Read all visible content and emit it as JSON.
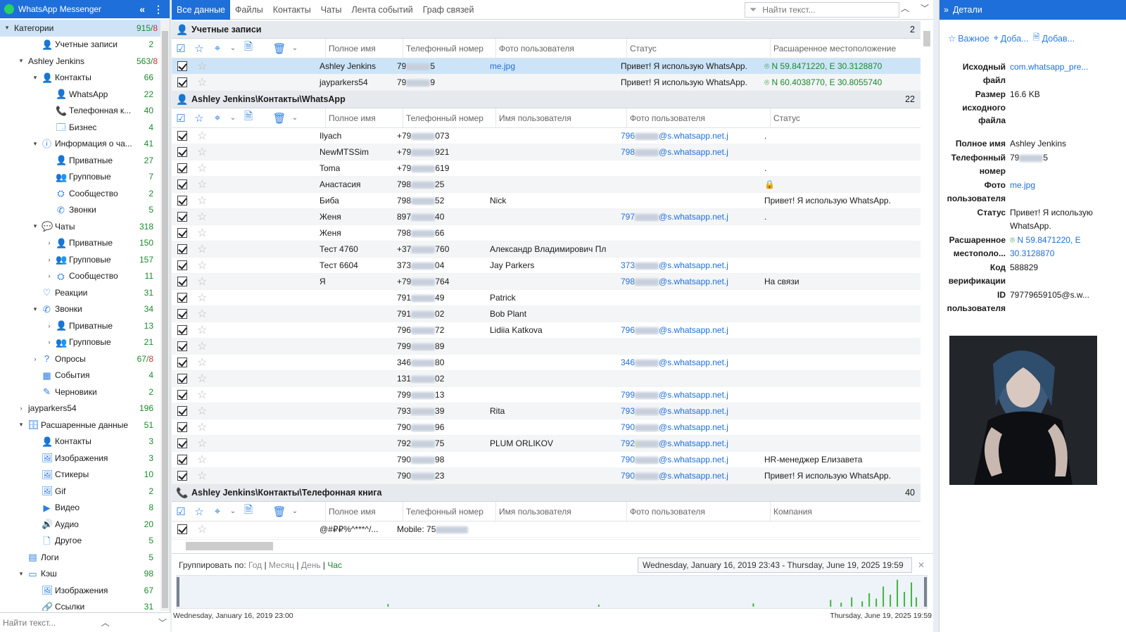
{
  "app": {
    "title": "WhatsApp Messenger"
  },
  "tree": [
    {
      "label": "Категории",
      "count": "915",
      "count_red": "8",
      "indent": 0,
      "toggle": "▾",
      "icon": "",
      "sel": true
    },
    {
      "label": "Учетные записи",
      "count": "2",
      "indent": 2,
      "toggle": "",
      "icon": "👤"
    },
    {
      "label": "Ashley Jenkins",
      "count": "563",
      "count_red": "8",
      "indent": 1,
      "toggle": "▾",
      "icon": ""
    },
    {
      "label": "Контакты",
      "count": "66",
      "indent": 2,
      "toggle": "▾",
      "icon": "👤"
    },
    {
      "label": "WhatsApp",
      "count": "22",
      "indent": 3,
      "toggle": "",
      "icon": "👤"
    },
    {
      "label": "Телефонная к...",
      "count": "40",
      "indent": 3,
      "toggle": "",
      "icon": "📞"
    },
    {
      "label": "Бизнес",
      "count": "4",
      "indent": 3,
      "toggle": "",
      "icon": "🗔"
    },
    {
      "label": "Информация о ча...",
      "count": "41",
      "indent": 2,
      "toggle": "▾",
      "icon": "ⓘ"
    },
    {
      "label": "Приватные",
      "count": "27",
      "indent": 3,
      "toggle": "",
      "icon": "👤"
    },
    {
      "label": "Групповые",
      "count": "7",
      "indent": 3,
      "toggle": "",
      "icon": "👥"
    },
    {
      "label": "Сообщество",
      "count": "2",
      "indent": 3,
      "toggle": "",
      "icon": "⛭"
    },
    {
      "label": "Звонки",
      "count": "5",
      "indent": 3,
      "toggle": "",
      "icon": "✆"
    },
    {
      "label": "Чаты",
      "count": "318",
      "indent": 2,
      "toggle": "▾",
      "icon": "💬"
    },
    {
      "label": "Приватные",
      "count": "150",
      "indent": 3,
      "toggle": "›",
      "icon": "👤"
    },
    {
      "label": "Групповые",
      "count": "157",
      "indent": 3,
      "toggle": "›",
      "icon": "👥"
    },
    {
      "label": "Сообщество",
      "count": "11",
      "indent": 3,
      "toggle": "›",
      "icon": "⛭"
    },
    {
      "label": "Реакции",
      "count": "31",
      "indent": 2,
      "toggle": "",
      "icon": "♡"
    },
    {
      "label": "Звонки",
      "count": "34",
      "indent": 2,
      "toggle": "▾",
      "icon": "✆"
    },
    {
      "label": "Приватные",
      "count": "13",
      "indent": 3,
      "toggle": "›",
      "icon": "👤"
    },
    {
      "label": "Групповые",
      "count": "21",
      "indent": 3,
      "toggle": "›",
      "icon": "👥"
    },
    {
      "label": "Опросы",
      "count": "67",
      "count_red": "8",
      "indent": 2,
      "toggle": "›",
      "icon": "?"
    },
    {
      "label": "События",
      "count": "4",
      "indent": 2,
      "toggle": "",
      "icon": "▦"
    },
    {
      "label": "Черновики",
      "count": "2",
      "indent": 2,
      "toggle": "",
      "icon": "✎"
    },
    {
      "label": "jayparkers54",
      "count": "196",
      "indent": 1,
      "toggle": "›",
      "icon": ""
    },
    {
      "label": "Расшаренные данные",
      "count": "51",
      "indent": 1,
      "toggle": "▾",
      "icon": "🗄"
    },
    {
      "label": "Контакты",
      "count": "3",
      "indent": 2,
      "toggle": "",
      "icon": "👤"
    },
    {
      "label": "Изображения",
      "count": "3",
      "indent": 2,
      "toggle": "",
      "icon": "🖼"
    },
    {
      "label": "Стикеры",
      "count": "10",
      "indent": 2,
      "toggle": "",
      "icon": "🖼"
    },
    {
      "label": "Gif",
      "count": "2",
      "indent": 2,
      "toggle": "",
      "icon": "🖼"
    },
    {
      "label": "Видео",
      "count": "8",
      "indent": 2,
      "toggle": "",
      "icon": "▶"
    },
    {
      "label": "Аудио",
      "count": "20",
      "indent": 2,
      "toggle": "",
      "icon": "🔊"
    },
    {
      "label": "Другое",
      "count": "5",
      "indent": 2,
      "toggle": "",
      "icon": "🗋"
    },
    {
      "label": "Логи",
      "count": "5",
      "indent": 1,
      "toggle": "",
      "icon": "▤"
    },
    {
      "label": "Кэш",
      "count": "98",
      "indent": 1,
      "toggle": "▾",
      "icon": "▭"
    },
    {
      "label": "Изображения",
      "count": "67",
      "indent": 2,
      "toggle": "",
      "icon": "🖼"
    },
    {
      "label": "Ссылки",
      "count": "31",
      "indent": 2,
      "toggle": "",
      "icon": "🔗"
    }
  ],
  "left_search": {
    "placeholder": "Найти текст..."
  },
  "tabs": [
    "Все данные",
    "Файлы",
    "Контакты",
    "Чаты",
    "Лента событий",
    "Граф связей"
  ],
  "center_search": {
    "placeholder": "Найти текст..."
  },
  "sections": [
    {
      "title": "Учетные записи",
      "count": "2",
      "icon": "👤",
      "columns": [
        "Полное имя",
        "Телефонный номер",
        "Фото пользователя",
        "Статус",
        "Расшаренное местоположение"
      ],
      "rows": [
        {
          "c": [
            "Ashley Jenkins",
            "79|5",
            "me.jpg",
            "Привет! Я использую WhatsApp.",
            "N 59.8471220, E 30.3128870"
          ],
          "sel": true
        },
        {
          "c": [
            "jayparkers54",
            "79|9",
            "",
            "Привет! Я использую WhatsApp.",
            "N 60.4038770, E 30.8055740"
          ]
        }
      ]
    },
    {
      "title": "Ashley Jenkins\\Контакты\\WhatsApp",
      "count": "22",
      "icon": "👤",
      "columns": [
        "Полное имя",
        "Телефонный номер",
        "Имя пользователя",
        "Фото пользователя",
        "Статус"
      ],
      "rows": [
        {
          "c": [
            "Ilyach",
            "+79|073",
            "",
            "796|@s.whatsapp.net.j",
            "."
          ]
        },
        {
          "c": [
            "NewMTSSim",
            "+79|921",
            "",
            "798|@s.whatsapp.net.j",
            ""
          ]
        },
        {
          "c": [
            "Toma",
            "+79|619",
            "",
            "",
            "."
          ]
        },
        {
          "c": [
            "Анастасия",
            "798|25",
            "",
            "",
            "🔒"
          ]
        },
        {
          "c": [
            "Биба",
            "798|52",
            "Nick",
            "",
            "Привет! Я использую WhatsApp."
          ]
        },
        {
          "c": [
            "Женя",
            "897|40",
            "",
            "797|@s.whatsapp.net.j",
            "."
          ]
        },
        {
          "c": [
            "Женя",
            "798|66",
            "",
            "",
            ""
          ]
        },
        {
          "c": [
            "Тест 4760",
            "+37|760",
            "Александр Владимирович Пл",
            "",
            ""
          ]
        },
        {
          "c": [
            "Тест 6604",
            "373|04",
            "Jay Parkers",
            "373|@s.whatsapp.net.j",
            ""
          ]
        },
        {
          "c": [
            "Я",
            "+79|764",
            "",
            "798|@s.whatsapp.net.j",
            "На связи"
          ]
        },
        {
          "c": [
            "",
            "791|49",
            "Patrick",
            "",
            ""
          ]
        },
        {
          "c": [
            "",
            "791|02",
            "Bob Plant",
            "",
            ""
          ]
        },
        {
          "c": [
            "",
            "796|72",
            "Lidiia Katkova",
            "796|@s.whatsapp.net.j",
            ""
          ]
        },
        {
          "c": [
            "",
            "799|89",
            "",
            "",
            ""
          ]
        },
        {
          "c": [
            "",
            "346|80",
            "",
            "346|@s.whatsapp.net.j",
            ""
          ]
        },
        {
          "c": [
            "",
            "131|02",
            "",
            "",
            ""
          ]
        },
        {
          "c": [
            "",
            "799|13",
            "",
            "799|@s.whatsapp.net.j",
            ""
          ]
        },
        {
          "c": [
            "",
            "793|39",
            "Rita",
            "793|@s.whatsapp.net.j",
            ""
          ]
        },
        {
          "c": [
            "",
            "790|96",
            "",
            "790|@s.whatsapp.net.j",
            ""
          ]
        },
        {
          "c": [
            "",
            "792|75",
            "PLUM ORLIKOV",
            "792|@s.whatsapp.net.j",
            ""
          ]
        },
        {
          "c": [
            "",
            "790|98",
            "",
            "790|@s.whatsapp.net.j",
            "HR-менеджер Елизавета"
          ]
        },
        {
          "c": [
            "",
            "790|23",
            "",
            "790|@s.whatsapp.net.j",
            "Привет! Я использую WhatsApp."
          ]
        }
      ]
    },
    {
      "title": "Ashley Jenkins\\Контакты\\Телефонная книга",
      "count": "40",
      "icon": "📞",
      "columns": [
        "Полное имя",
        "Телефонный номер",
        "Имя пользователя",
        "Фото пользователя",
        "Компания"
      ],
      "rows": [
        {
          "c": [
            "@#₽₽%^***^/...",
            "Mobile: 75|",
            "",
            "",
            ""
          ]
        }
      ]
    }
  ],
  "timeline": {
    "group_by": "Группировать по:",
    "options": [
      "Год",
      "Месяц",
      "День",
      "Час"
    ],
    "active": "Час",
    "range": "Wednesday, January 16, 2019 23:43 - Thursday, June 19, 2025 19:59",
    "start": "Wednesday, January 16, 2019 23:00",
    "end": "Thursday, June 19, 2025 19:59"
  },
  "details": {
    "title": "Детали",
    "actions": [
      "Важное",
      "Доба...",
      "Добав..."
    ],
    "fields": [
      {
        "k": "Исходный файл",
        "v": "com.whatsapp_pre...",
        "link": true
      },
      {
        "k": "Размер исходного файла",
        "v": "16.6 KB"
      },
      {
        "k": "Полное имя",
        "v": "Ashley Jenkins",
        "gap": true
      },
      {
        "k": "Телефонный номер",
        "v": "79|5"
      },
      {
        "k": "Фото пользователя",
        "v": "me.jpg",
        "link": true
      },
      {
        "k": "Статус",
        "v": "Привет! Я использую WhatsApp."
      },
      {
        "k": "Расшаренное местополо...",
        "v": "N 59.8471220, E 30.3128870",
        "geo": true
      },
      {
        "k": "Код верификации",
        "v": "588829"
      },
      {
        "k": "ID пользователя",
        "v": "79779659105@s.w..."
      }
    ]
  },
  "colors": {
    "accent": "#1e6fd9",
    "count_green": "#1a8a2a",
    "count_red": "#d32f2f"
  }
}
